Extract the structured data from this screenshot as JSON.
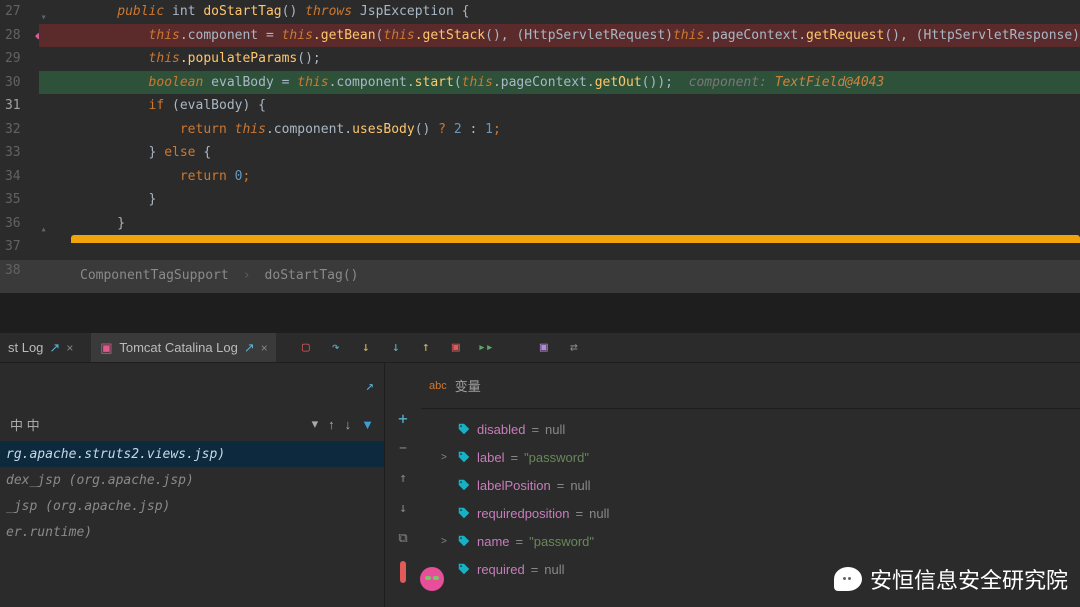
{
  "gutter": {
    "start": 27,
    "end": 38,
    "highlighted": 31
  },
  "code": {
    "l27": {
      "ind": "        ",
      "p1": "public",
      "p2": " int ",
      "p3": "doStartTag",
      "p4": "() ",
      "p5": "throws",
      "p6": " JspException {"
    },
    "l28": {
      "ind": "            ",
      "t": "this",
      "d1": ".component = ",
      "t2": "this",
      "m1": ".getBean",
      "p1": "(",
      "t3": "this",
      "m2": ".getStack",
      "p2": "(), (HttpServletRequest)",
      "t4": "this",
      "d2": ".pageContext.",
      "m3": "getRequest",
      "p3": "(), (HttpServletResponse)"
    },
    "l29": {
      "ind": "            ",
      "t": "this",
      "m": ".populateParams",
      "p": "();"
    },
    "l30": {
      "ind": "            ",
      "kw": "boolean",
      "sp": " evalBody = ",
      "t": "this",
      "d": ".component.",
      "m": "start",
      "p1": "(",
      "t2": "this",
      "d2": ".pageContext.",
      "m2": "getOut",
      "p2": "());",
      "hintLbl": "  component: ",
      "hintVal": "TextField@4043"
    },
    "l31": {
      "ind": "            ",
      "kw": "if",
      "p": " (evalBody) {"
    },
    "l32": {
      "ind": "                ",
      "kw": "return",
      "sp": " ",
      "t": "this",
      "d": ".component.",
      "m": "usesBody",
      "p1": "() ",
      "q": "?",
      "sp2": " ",
      "n1": "2",
      "c": " : ",
      "n2": "1",
      "sc": ";"
    },
    "l33": {
      "ind": "            ",
      "p1": "} ",
      "kw": "else",
      "p2": " {"
    },
    "l34": {
      "ind": "                ",
      "kw": "return",
      "sp": " ",
      "n": "0",
      "sc": ";"
    },
    "l35": {
      "ind": "            ",
      "p": "}"
    },
    "l36": {
      "ind": "        ",
      "p": "}"
    }
  },
  "breadcrumb": {
    "a": "ComponentTagSupport",
    "b": "doStartTag()"
  },
  "tooltabs": {
    "t1": {
      "label": "st Log",
      "hasOpen": true
    },
    "t2": {
      "label": "Tomcat Catalina Log",
      "hasOpen": true
    }
  },
  "framesPanel": {
    "threadsRowLabel": "中 中",
    "items": [
      {
        "text": "rg.apache.struts2.views.jsp)",
        "selected": true
      },
      {
        "text": "dex_jsp (org.apache.jsp)",
        "selected": false
      },
      {
        "text": "_jsp (org.apache.jsp)",
        "selected": false
      },
      {
        "text": "er.runtime)",
        "selected": false
      }
    ]
  },
  "varsPanel": {
    "headerLabel": "变量",
    "abcPrefix": "abc",
    "rows": [
      {
        "expand": "",
        "name": "disabled",
        "value": "null",
        "isStr": false
      },
      {
        "expand": ">",
        "name": "label",
        "value": "\"password\"",
        "isStr": true
      },
      {
        "expand": "",
        "name": "labelPosition",
        "value": "null",
        "isStr": false
      },
      {
        "expand": "",
        "name": "requiredposition",
        "value": "null",
        "isStr": false
      },
      {
        "expand": ">",
        "name": "name",
        "value": "\"password\"",
        "isStr": true
      },
      {
        "expand": "",
        "name": "required",
        "value": "null",
        "isStr": false
      }
    ]
  },
  "watermark": "安恒信息安全研究院"
}
